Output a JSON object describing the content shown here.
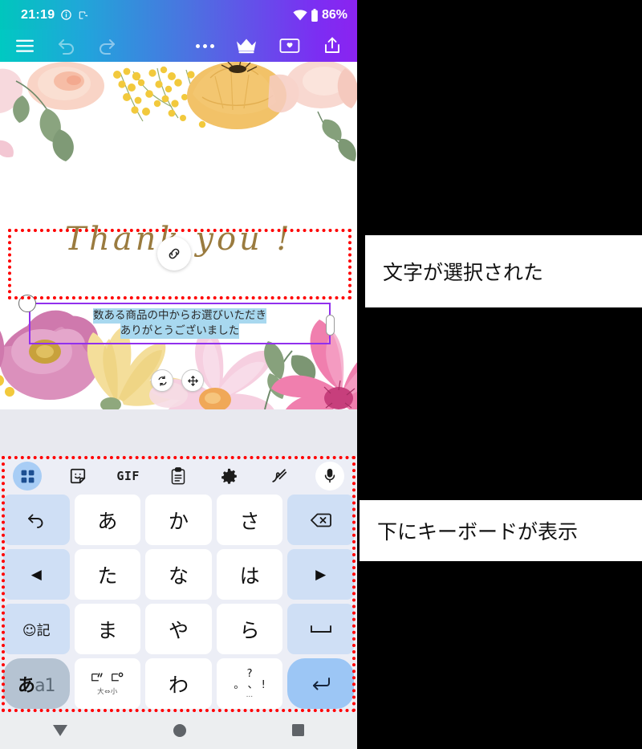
{
  "status_bar": {
    "time": "21:19",
    "battery": "86%",
    "icons": [
      "info-icon",
      "screen-rotation-lock-icon",
      "wifi-icon",
      "battery-icon"
    ]
  },
  "app_toolbar": {
    "menu_label": "hamburger-menu",
    "undo_label": "undo",
    "redo_label": "redo",
    "more_label": "more-options",
    "crown_label": "premium",
    "save_label": "save-to-gallery",
    "share_label": "share"
  },
  "canvas": {
    "script_text": "Thank  you  !",
    "link_badge": "link-icon",
    "selected_text": {
      "line1": "数ある商品の中からお選びいただき",
      "line2": "ありがとうございました",
      "selection_color": "#a8d8ef",
      "frame_color": "#9130ee"
    },
    "fabs": [
      {
        "name": "rotate-handle",
        "icon": "rotate-icon"
      },
      {
        "name": "move-handle",
        "icon": "move-icon"
      }
    ]
  },
  "annotations": {
    "highlight_color": "#ff0000",
    "note_1": "文字が選択された",
    "note_2": "下にキーボードが表示"
  },
  "keyboard": {
    "toolbar": [
      {
        "name": "keyboard-switch-icon",
        "label": "",
        "selected": true
      },
      {
        "name": "sticker-icon",
        "label": "",
        "selected": false
      },
      {
        "name": "gif-icon",
        "label": "GIF",
        "selected": false
      },
      {
        "name": "clipboard-icon",
        "label": "",
        "selected": false
      },
      {
        "name": "settings-gear-icon",
        "label": "",
        "selected": false
      },
      {
        "name": "handwriting-icon",
        "label": "",
        "selected": false
      },
      {
        "name": "microphone-icon",
        "label": "",
        "selected": false
      }
    ],
    "rows": [
      [
        {
          "name": "key-undo",
          "label": "↰",
          "type": "fn"
        },
        {
          "name": "key-a",
          "label": "あ",
          "type": "char"
        },
        {
          "name": "key-ka",
          "label": "か",
          "type": "char"
        },
        {
          "name": "key-sa",
          "label": "さ",
          "type": "char"
        },
        {
          "name": "key-backspace",
          "label": "⌫",
          "type": "fn"
        }
      ],
      [
        {
          "name": "key-cursor-left",
          "label": "◀",
          "type": "fn"
        },
        {
          "name": "key-ta",
          "label": "た",
          "type": "char"
        },
        {
          "name": "key-na",
          "label": "な",
          "type": "char"
        },
        {
          "name": "key-ha",
          "label": "は",
          "type": "char"
        },
        {
          "name": "key-cursor-right",
          "label": "▶",
          "type": "fn"
        }
      ],
      [
        {
          "name": "key-emoji-symbol",
          "label": "☺記",
          "type": "fn"
        },
        {
          "name": "key-ma",
          "label": "ま",
          "type": "char"
        },
        {
          "name": "key-ya",
          "label": "や",
          "type": "char"
        },
        {
          "name": "key-ra",
          "label": "ら",
          "type": "char"
        },
        {
          "name": "key-space",
          "label": "␣",
          "type": "fn"
        }
      ],
      [
        {
          "name": "key-input-mode",
          "label": "あa1",
          "type": "mode"
        },
        {
          "name": "key-dakuten",
          "label": "゛ ゜",
          "sub": "大⇔小",
          "type": "char"
        },
        {
          "name": "key-wa",
          "label": "わ",
          "type": "char"
        },
        {
          "name": "key-punctuation",
          "label": "、。?!",
          "sub": "…",
          "type": "char"
        },
        {
          "name": "key-enter",
          "label": "↵",
          "type": "enter"
        }
      ]
    ]
  },
  "nav_bar": {
    "back": "back-triangle-icon",
    "home": "home-circle-icon",
    "recents": "recents-square-icon"
  }
}
